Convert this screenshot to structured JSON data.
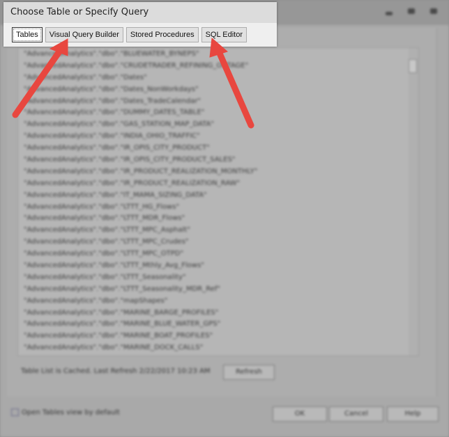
{
  "dialog_title": "Choose Table or Specify Query",
  "tabs": [
    {
      "label": "Tables",
      "active": true
    },
    {
      "label": "Visual Query Builder"
    },
    {
      "label": "Stored Procedures"
    },
    {
      "label": "SQL Editor"
    }
  ],
  "table_list": [
    "\"AdvancedAnalytics\".\"dbo\".\"BLUEWATER_BYNEPS\"",
    "\"AdvancedAnalytics\".\"dbo\".\"CRUDETRADER_REFINING_OUTAGE\"",
    "\"AdvancedAnalytics\".\"dbo\".\"Dates\"",
    "\"AdvancedAnalytics\".\"dbo\".\"Dates_NonWorkdays\"",
    "\"AdvancedAnalytics\".\"dbo\".\"Dates_TradeCalendar\"",
    "\"AdvancedAnalytics\".\"dbo\".\"DUMMY_DATES_TABLE\"",
    "\"AdvancedAnalytics\".\"dbo\".\"GAS_STATION_MAP_DATA\"",
    "\"AdvancedAnalytics\".\"dbo\".\"INDIA_OHIO_TRAFFIC\"",
    "\"AdvancedAnalytics\".\"dbo\".\"IR_OPIS_CITY_PRODUCT\"",
    "\"AdvancedAnalytics\".\"dbo\".\"IR_OPIS_CITY_PRODUCT_SALES\"",
    "\"AdvancedAnalytics\".\"dbo\".\"IR_PRODUCT_REALIZATION_MONTHLY\"",
    "\"AdvancedAnalytics\".\"dbo\".\"IR_PRODUCT_REALIZATION_RAW\"",
    "\"AdvancedAnalytics\".\"dbo\".\"IT_MAMA_SIZING_DATA\"",
    "\"AdvancedAnalytics\".\"dbo\".\"LTTT_HG_Flows\"",
    "\"AdvancedAnalytics\".\"dbo\".\"LTTT_MDR_Flows\"",
    "\"AdvancedAnalytics\".\"dbo\".\"LTTT_MPC_Asphalt\"",
    "\"AdvancedAnalytics\".\"dbo\".\"LTTT_MPC_Crudes\"",
    "\"AdvancedAnalytics\".\"dbo\".\"LTTT_MPC_OTPD\"",
    "\"AdvancedAnalytics\".\"dbo\".\"LTTT_Mthly_Avg_Flows\"",
    "\"AdvancedAnalytics\".\"dbo\".\"LTTT_Seasonality\"",
    "\"AdvancedAnalytics\".\"dbo\".\"LTTT_Seasonality_MDR_Ref\"",
    "\"AdvancedAnalytics\".\"dbo\".\"mapShapes\"",
    "\"AdvancedAnalytics\".\"dbo\".\"MARINE_BARGE_PROFILES\"",
    "\"AdvancedAnalytics\".\"dbo\".\"MARINE_BLUE_WATER_GPS\"",
    "\"AdvancedAnalytics\".\"dbo\".\"MARINE_BOAT_PROFILES\"",
    "\"AdvancedAnalytics\".\"dbo\".\"MARINE_DOCK_CALLS\""
  ],
  "status_text": "Table List is Cached. Last Refresh 2/22/2017 10:23 AM",
  "refresh_label": "Refresh",
  "open_tables_label": "Open Tables view by default",
  "open_tables_checked": true,
  "ok_label": "OK",
  "cancel_label": "Cancel",
  "help_label": "Help",
  "arrow_color": "#e8473f"
}
